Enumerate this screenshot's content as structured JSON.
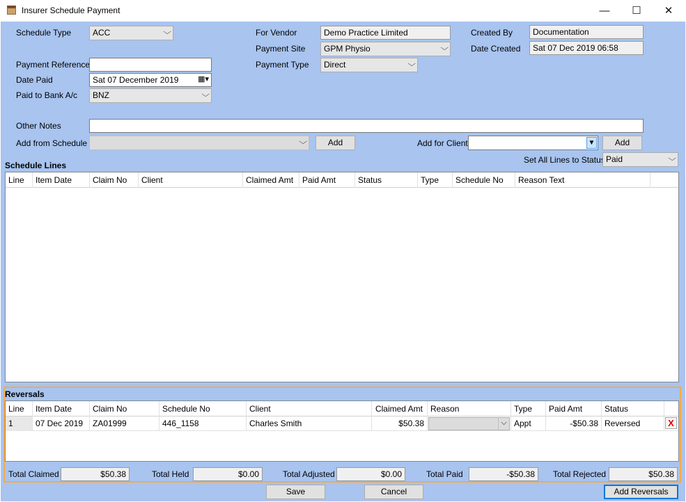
{
  "window": {
    "title": "Insurer Schedule Payment",
    "minimize": "—",
    "maximize": "☐",
    "close": "✕"
  },
  "form": {
    "schedule_type_label": "Schedule Type",
    "schedule_type_value": "ACC",
    "payment_reference_label": "Payment Reference",
    "payment_reference_value": "",
    "date_paid_label": "Date Paid",
    "date_paid_value": "Sat  07 December 2019",
    "paid_to_bank_label": "Paid to Bank A/c",
    "paid_to_bank_value": "BNZ",
    "for_vendor_label": "For Vendor",
    "for_vendor_value": "Demo Practice Limited",
    "payment_site_label": "Payment Site",
    "payment_site_value": "GPM Physio",
    "payment_type_label": "Payment Type",
    "payment_type_value": "Direct",
    "created_by_label": "Created By",
    "created_by_value": "Documentation",
    "date_created_label": "Date Created",
    "date_created_value": "Sat 07 Dec 2019 06:58",
    "other_notes_label": "Other Notes",
    "other_notes_value": "",
    "add_from_schedule_label": "Add from Schedule",
    "add_from_schedule_value": "",
    "add_label": "Add",
    "add_for_client_label": "Add for Client",
    "add_for_client_value": "",
    "add_client_label": "Add",
    "set_all_label": "Set All Lines to Status",
    "set_all_value": "Paid"
  },
  "schedule_lines": {
    "title": "Schedule Lines",
    "columns": [
      "Line",
      "Item Date",
      "Claim No",
      "Client",
      "Claimed Amt",
      "Paid Amt",
      "Status",
      "Type",
      "Schedule No",
      "Reason Text"
    ]
  },
  "reversals": {
    "title": "Reversals",
    "columns": [
      "Line",
      "Item Date",
      "Claim No",
      "Schedule No",
      "Client",
      "Claimed Amt",
      "Reason",
      "Type",
      "Paid Amt",
      "Status"
    ],
    "rows": [
      {
        "line": "1",
        "item_date": "07 Dec 2019",
        "claim_no": "ZA01999",
        "schedule_no": "446_1158",
        "client": "Charles Smith",
        "claimed_amt": "$50.38",
        "reason": "",
        "type": "Appt",
        "paid_amt": "-$50.38",
        "status": "Reversed",
        "delete": "X"
      }
    ]
  },
  "totals": {
    "claimed_label": "Total Claimed",
    "claimed_value": "$50.38",
    "held_label": "Total Held",
    "held_value": "$0.00",
    "adjusted_label": "Total Adjusted",
    "adjusted_value": "$0.00",
    "paid_label": "Total Paid",
    "paid_value": "-$50.38",
    "rejected_label": "Total Rejected",
    "rejected_value": "$50.38"
  },
  "buttons": {
    "save": "Save",
    "cancel": "Cancel",
    "add_reversals": "Add Reversals"
  },
  "icons": {
    "dropdown": "chevron-down-icon",
    "calendar": "calendar-icon",
    "delete": "delete-icon"
  },
  "colors": {
    "client_bg": "#a8c4ef",
    "highlight": "#f5a94a",
    "focus": "#0078d7",
    "delete": "#e00000"
  }
}
